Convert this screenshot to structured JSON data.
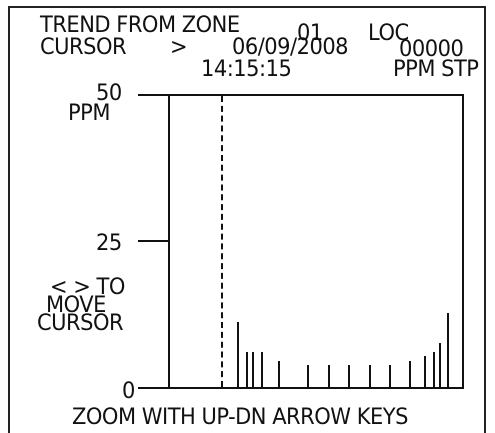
{
  "header": {
    "line1_title": "TREND FROM ZONE",
    "line1_zone": "01",
    "line1_loc": "LOC",
    "line2_cursor": "CURSOR",
    "line2_arrow": ">",
    "line2_date": "06/09/2008",
    "line2_value": "00000",
    "line3_time": "14:15:15",
    "line3_units": "PPM STP"
  },
  "axis": {
    "y_max": "50",
    "y_unit": "PPM",
    "y_mid": "25",
    "y_min": "0"
  },
  "help": {
    "line1": "< > TO",
    "line2": "MOVE",
    "line3": "CURSOR",
    "footer": "ZOOM WITH UP-DN ARROW KEYS"
  },
  "chart_data": {
    "type": "line",
    "ylabel": "PPM",
    "ylim": [
      0,
      50
    ],
    "y_ticks": [
      0,
      25,
      50
    ],
    "cursor_position_fraction": 0.18,
    "series": [
      {
        "values": [
          {
            "x": 0.23,
            "y": 1.5
          },
          {
            "x": 0.26,
            "y": 0.8
          },
          {
            "x": 0.28,
            "y": 0.8
          },
          {
            "x": 0.31,
            "y": 0.8
          },
          {
            "x": 0.37,
            "y": 0.6
          },
          {
            "x": 0.47,
            "y": 0.5
          },
          {
            "x": 0.54,
            "y": 0.5
          },
          {
            "x": 0.61,
            "y": 0.5
          },
          {
            "x": 0.68,
            "y": 0.5
          },
          {
            "x": 0.75,
            "y": 0.5
          },
          {
            "x": 0.82,
            "y": 0.6
          },
          {
            "x": 0.87,
            "y": 0.7
          },
          {
            "x": 0.9,
            "y": 0.8
          },
          {
            "x": 0.92,
            "y": 1.0
          },
          {
            "x": 0.95,
            "y": 1.7
          }
        ]
      }
    ]
  }
}
